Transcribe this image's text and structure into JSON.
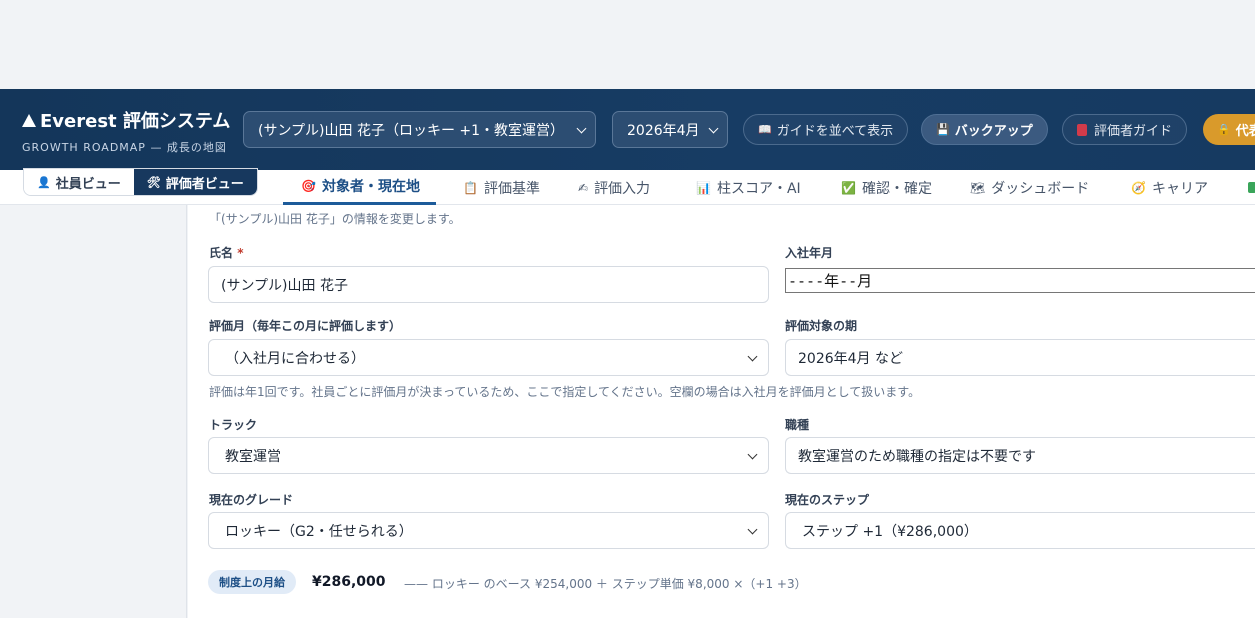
{
  "header": {
    "brand_title": "Everest 評価システム",
    "brand_subtitle": "GROWTH ROADMAP — 成長の地図",
    "employee_select": "(サンプル)山田 花子（ロッキー +1・教室運営）",
    "period_select": "2026年4月",
    "guide_side_by_side": "ガイドを並べて表示",
    "backup": "バックアップ",
    "evaluator_guide": "評価者ガイド",
    "proxy_button": "代表"
  },
  "view_toggle": {
    "employee_view": "社員ビュー",
    "evaluator_view": "評価者ビュー"
  },
  "tabs": [
    {
      "label": "対象者・現在地",
      "icon": "target-icon"
    },
    {
      "label": "評価基準",
      "icon": "clipboard-icon"
    },
    {
      "label": "評価入力",
      "icon": "writing-hand-icon"
    },
    {
      "label": "柱スコア・AI",
      "icon": "bar-chart-icon"
    },
    {
      "label": "確認・確定",
      "icon": "check-box-icon"
    },
    {
      "label": "ダッシュボード",
      "icon": "map-icon"
    },
    {
      "label": "キャリア",
      "icon": "compass-icon"
    }
  ],
  "form": {
    "edit_note": "「(サンプル)山田 花子」の情報を変更します。",
    "name_label": "氏名",
    "required_mark": "*",
    "name_value": "(サンプル)山田 花子",
    "join_label": "入社年月",
    "join_value": "----年--月",
    "eval_month_label": "評価月（毎年この月に評価します）",
    "eval_month_value": "（入社月に合わせる）",
    "eval_period_label": "評価対象の期",
    "eval_period_placeholder": "2026年4月 など",
    "eval_help": "評価は年1回です。社員ごとに評価月が決まっているため、ここで指定してください。空欄の場合は入社月を評価月として扱います。",
    "track_label": "トラック",
    "track_value": "教室運営",
    "job_label": "職種",
    "job_value": "教室運営のため職種の指定は不要です",
    "grade_label": "現在のグレード",
    "grade_value": "ロッキー（G2・任せられる）",
    "step_label": "現在のステップ",
    "step_value": "ステップ +1（¥286,000）"
  },
  "salary": {
    "badge": "制度上の月給",
    "amount": "¥286,000",
    "formula": "—— ロッキー のベース ¥254,000 ＋ ステップ単価 ¥8,000 ×（+1 +3）"
  },
  "colors": {
    "header_bg": "#14365a",
    "accent_blue": "#1d5b9a",
    "proxy_orange": "#d99a2b"
  }
}
